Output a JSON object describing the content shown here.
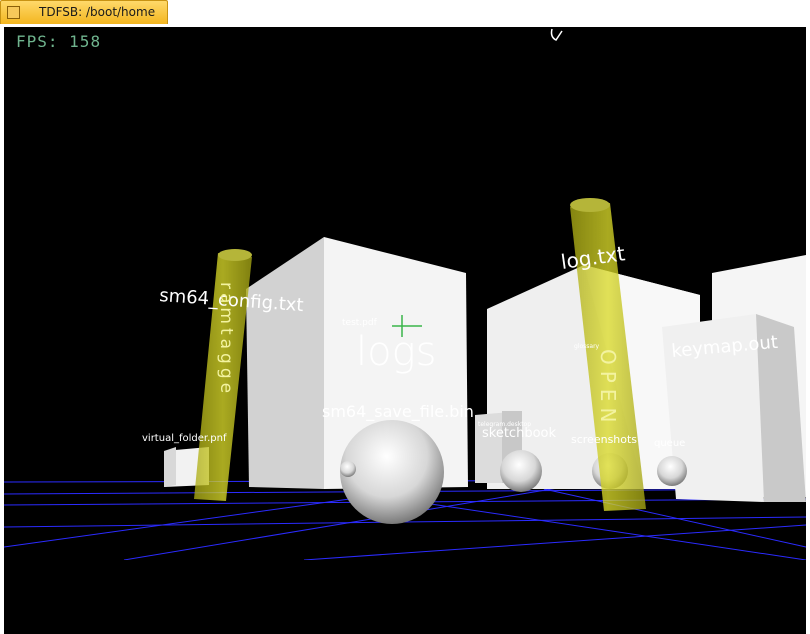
{
  "window": {
    "title": "TDFSB: /boot/home",
    "icon": "app-icon"
  },
  "hud": {
    "fps_label": "FPS:",
    "fps_value": "158"
  },
  "scene": {
    "background": "#000000",
    "grid_color": "#2b2bff",
    "pillar_color": "#d6d61e",
    "labels": {
      "logs": "logs",
      "test_pdf": "test.pdf",
      "sm64_config": "sm64_config.txt",
      "sm64_save": "sm64_save_file.bin",
      "log_txt": "log.txt",
      "keymap": "keymap.out",
      "sketchbook": "sketchbook",
      "telegram": "telegram.desktop",
      "screenshots": "screenshots",
      "queue": "queue",
      "virtual_folder": "virtual_folder.pnf",
      "glossary": "glossary",
      "pillar_left_text": "ramtagge",
      "pillar_right_text": "OPEN"
    }
  }
}
